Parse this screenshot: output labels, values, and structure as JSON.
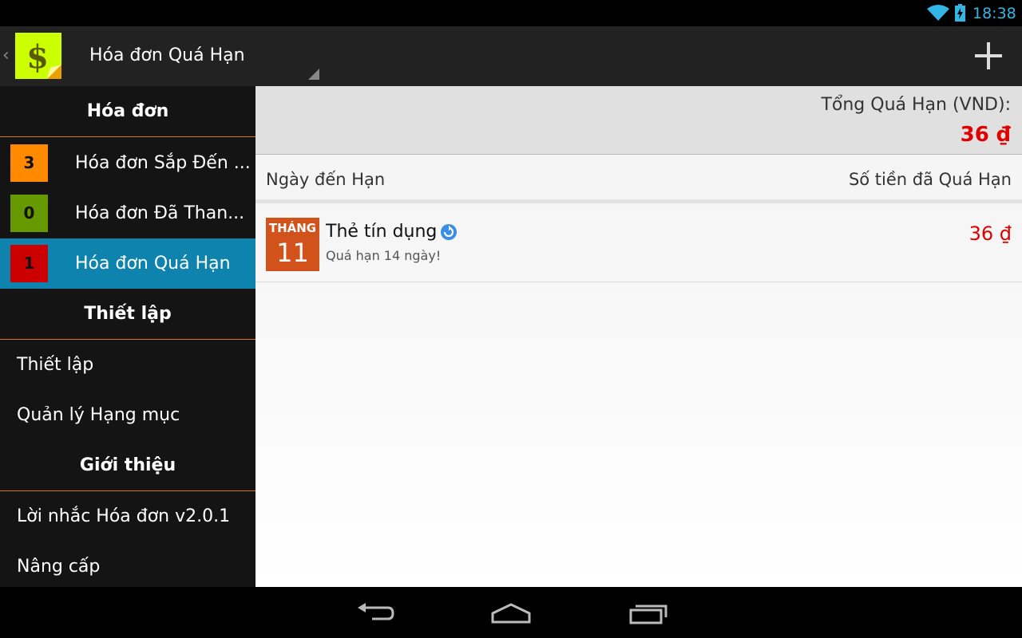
{
  "status_bar": {
    "time": "18:38",
    "wifi_icon": "wifi-icon",
    "battery_icon": "battery-charging-icon"
  },
  "action_bar": {
    "logo_icon": "dollar-sticky-note-icon",
    "title": "Hóa đơn Quá Hạn",
    "add_icon": "plus-icon"
  },
  "sidebar": {
    "sections": [
      {
        "header": "Hóa đơn"
      },
      {
        "header": "Thiết lập"
      },
      {
        "header": "Giới thiệu"
      }
    ],
    "bill_items": [
      {
        "count": "3",
        "label": "Hóa đơn Sắp Đến ...",
        "badge_color": "#ff8a00"
      },
      {
        "count": "0",
        "label": "Hóa đơn Đã Than...",
        "badge_color": "#669900"
      },
      {
        "count": "1",
        "label": "Hóa đơn Quá Hạn",
        "badge_color": "#cc0000"
      }
    ],
    "settings_items": [
      {
        "label": "Thiết lập"
      },
      {
        "label": "Quản lý Hạng mục"
      }
    ],
    "about_items": [
      {
        "label": "Lời nhắc Hóa đơn v2.0.1"
      },
      {
        "label": "Nâng cấp"
      }
    ]
  },
  "main": {
    "summary_label": "Tổng Quá Hạn (VND):",
    "summary_total": "36 ₫",
    "column_date": "Ngày đến Hạn",
    "column_amount": "Số tiền đã Quá Hạn",
    "bills": [
      {
        "month": "THÁNG",
        "day": "11",
        "name": "Thẻ tín dụng",
        "status": "Quá hạn 14 ngày!",
        "amount": "36 ₫",
        "repeat_icon": "repeat-icon"
      }
    ]
  },
  "colors": {
    "accent": "#33b5e5",
    "active_item": "#0e83ad",
    "overdue": "#e00000",
    "date_tile": "#d2521c",
    "divider": "#e07020"
  }
}
